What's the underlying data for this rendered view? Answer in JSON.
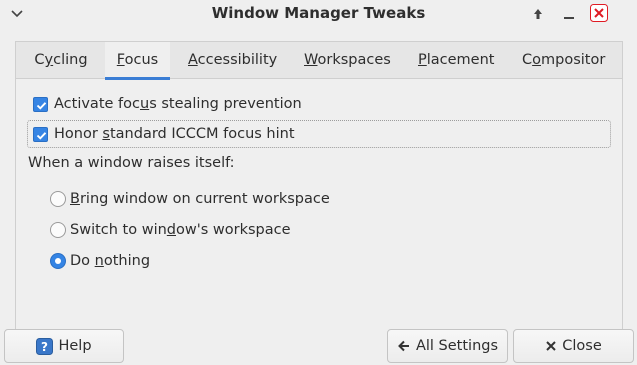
{
  "window": {
    "title": "Window Manager Tweaks"
  },
  "tabs": [
    {
      "label": "Cycling",
      "mnemonic_index": 1
    },
    {
      "label": "Focus",
      "mnemonic_index": 0,
      "active": true
    },
    {
      "label": "Accessibility",
      "mnemonic_index": 0
    },
    {
      "label": "Workspaces",
      "mnemonic_index": 0
    },
    {
      "label": "Placement",
      "mnemonic_index": 0
    },
    {
      "label": "Compositor",
      "mnemonic_index": 1
    }
  ],
  "focus": {
    "steal_prevention": {
      "pre": "Activate foc",
      "mn": "u",
      "post": "s stealing prevention",
      "checked": true
    },
    "icccm_hint": {
      "pre": "Honor ",
      "mn": "s",
      "post": "tandard ICCCM focus hint",
      "checked": true
    },
    "raise_heading": "When a window raises itself:",
    "raise_options": [
      {
        "pre": "",
        "mn": "B",
        "post": "ring window on current workspace",
        "checked": false
      },
      {
        "pre": "Switch to win",
        "mn": "d",
        "post": "ow's workspace",
        "checked": false
      },
      {
        "pre": "Do ",
        "mn": "n",
        "post": "othing",
        "checked": true
      }
    ]
  },
  "buttons": {
    "help": "Help",
    "all_settings": "All Settings",
    "close": "Close"
  },
  "colors": {
    "accent": "#3584e4",
    "tab_indicator": "#3b7ed5",
    "close_icon": "#e01b24"
  }
}
